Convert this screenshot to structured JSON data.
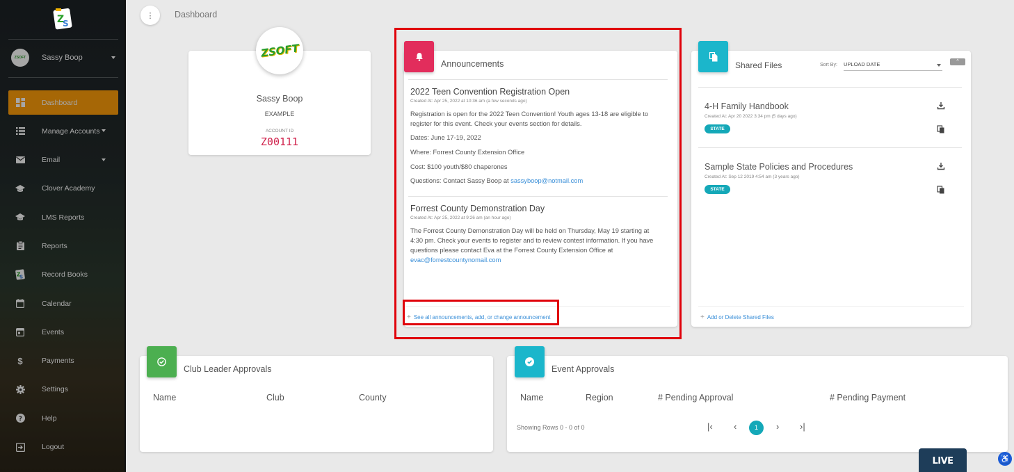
{
  "sidebar": {
    "user_name": "Sassy Boop",
    "avatar_text": "ZSOFT",
    "items": [
      {
        "label": "Dashboard",
        "icon": "dashboard-icon",
        "active": true
      },
      {
        "label": "Manage Accounts",
        "icon": "list-icon",
        "dropdown": true
      },
      {
        "label": "Email",
        "icon": "mail-icon",
        "dropdown": true
      },
      {
        "label": "Clover Academy",
        "icon": "graduation-cap-icon"
      },
      {
        "label": "LMS Reports",
        "icon": "graduation-cap-icon"
      },
      {
        "label": "Reports",
        "icon": "clipboard-icon"
      },
      {
        "label": "Record Books",
        "icon": "zs-logo-icon"
      },
      {
        "label": "Calendar",
        "icon": "calendar-icon"
      },
      {
        "label": "Events",
        "icon": "event-icon"
      },
      {
        "label": "Payments",
        "icon": "dollar-icon"
      },
      {
        "label": "Settings",
        "icon": "gear-icon"
      },
      {
        "label": "Help",
        "icon": "help-icon"
      },
      {
        "label": "Logout",
        "icon": "logout-icon"
      }
    ]
  },
  "header": {
    "breadcrumb": "Dashboard"
  },
  "profile": {
    "logo_text": "ZSOFT",
    "name": "Sassy Boop",
    "subtitle": "EXAMPLE",
    "id_label": "ACCOUNT ID",
    "id_value": "Z00111"
  },
  "announcements": {
    "title": "Announcements",
    "items": [
      {
        "title": "2022 Teen Convention Registration Open",
        "meta": "Created At: Apr 25, 2022 at 10:36 am (a few seconds ago)",
        "body": "Registration is open for the 2022 Teen Convention! Youth ages 13-18 are eligible to register for this event. Check your events section for details.",
        "dates": "Dates: June 17-19, 2022",
        "where": "Where: Forrest County Extension Office",
        "cost": "Cost: $100 youth/$80 chaperones",
        "questions": "Questions: Contact Sassy Boop at ",
        "email": "sassyboop@notmail.com"
      },
      {
        "title": "Forrest County Demonstration Day",
        "meta": "Created At: Apr 25, 2022 at 9:26 am (an hour ago)",
        "body": "The Forrest County Demonstration Day will be held on Thursday, May 19 starting at 4:30 pm. Check your events to register and to review contest information. If you have questions please contact Eva at the Forrest County Extension Office at ",
        "email": "evac@forrestcountynomail.com"
      }
    ],
    "footer_link": "See all announcements, add, or change announcement"
  },
  "shared_files": {
    "title": "Shared Files",
    "sort_label": "Sort By:",
    "sort_value": "UPLOAD DATE",
    "sort_toggle": "^",
    "files": [
      {
        "title": "4-H Family Handbook",
        "meta": "Created At: Apr 20 2022 3:34 pm (5 days ago)",
        "badge": "STATE"
      },
      {
        "title": "Sample State Policies and Procedures",
        "meta": "Created At: Sep 12 2019 4:54 am (3 years ago)",
        "badge": "STATE"
      }
    ],
    "footer_link": "Add or Delete Shared Files"
  },
  "club_approvals": {
    "title": "Club Leader Approvals",
    "columns": [
      "Name",
      "Club",
      "County"
    ]
  },
  "event_approvals": {
    "title": "Event Approvals",
    "columns": [
      "Name",
      "Region",
      "# Pending Approval",
      "# Pending Payment"
    ],
    "showing": "Showing Rows 0 - 0 of 0",
    "current_page": "1"
  },
  "live_chat": "LIVE CHAT",
  "colors": {
    "accent": "#ff9e0a",
    "announce": "#e22d5c",
    "files": "#1bb6cb",
    "club": "#4caf50",
    "teal": "#14a8b8",
    "highlight": "#e0000a"
  }
}
